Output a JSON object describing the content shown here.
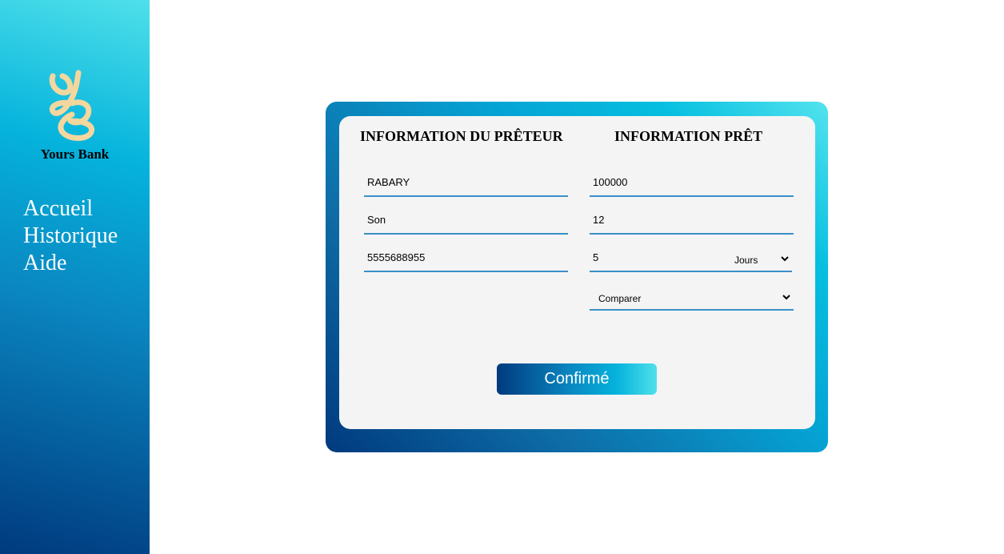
{
  "sidebar": {
    "logo": {
      "text": "YB",
      "color": "#f3d79e",
      "icon": "yb-monogram-logo"
    },
    "brand_name": "Yours Bank",
    "nav": [
      {
        "label": "Accueil"
      },
      {
        "label": "Historique"
      },
      {
        "label": "Aide"
      }
    ]
  },
  "form": {
    "lender_heading": "INFORMATION DU PRÊTEUR",
    "loan_heading": "INFORMATION PRÊT",
    "lender": {
      "last_name": "RABARY",
      "first_name": "Son",
      "phone": "5555688955"
    },
    "loan": {
      "amount": "100000",
      "rate": "12",
      "duration": "5",
      "duration_unit": "Jours",
      "compare": "Comparer"
    },
    "confirm_label": "Confirmé"
  },
  "colors": {
    "accent_dark": "#003a7e",
    "accent_light": "#4fe0ea",
    "field_underline": "#3a8fc8",
    "card_bg": "#f4f4f4"
  }
}
